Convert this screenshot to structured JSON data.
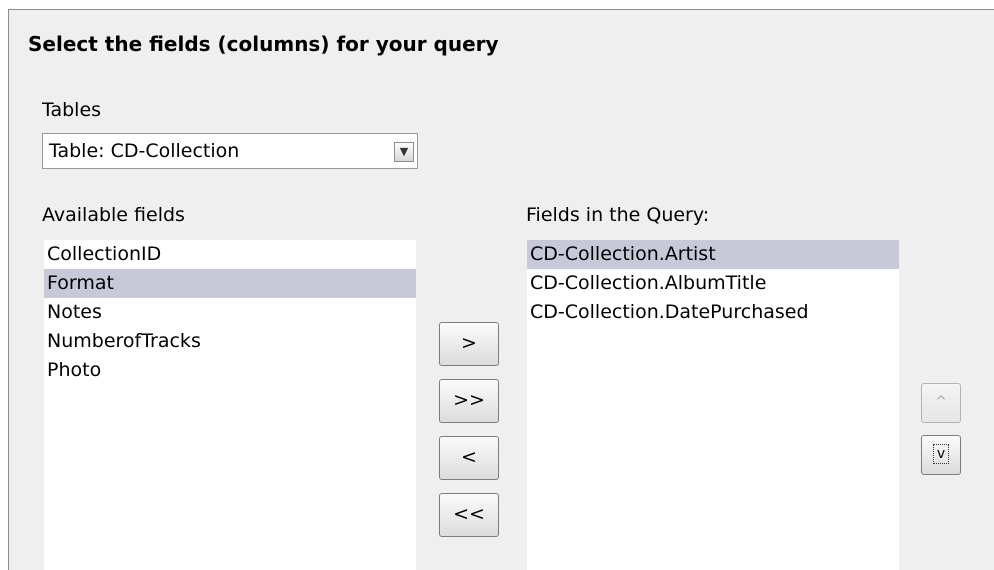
{
  "heading": "Select the fields (columns) for your query",
  "tables": {
    "label": "Tables",
    "selected": "Table: CD-Collection",
    "dropdown_icon": "chevron-down-icon"
  },
  "available": {
    "label": "Available fields",
    "items": [
      "CollectionID",
      "Format",
      "Notes",
      "NumberofTracks",
      "Photo"
    ],
    "selected": "Format"
  },
  "query": {
    "label": "Fields in the Query:",
    "items": [
      "CD-Collection.Artist",
      "CD-Collection.AlbumTitle",
      "CD-Collection.DatePurchased"
    ],
    "selected": "CD-Collection.Artist"
  },
  "buttons": {
    "add": ">",
    "add_all": ">>",
    "remove": "<",
    "remove_all": "<<",
    "move_up": "^",
    "move_down": "v"
  }
}
